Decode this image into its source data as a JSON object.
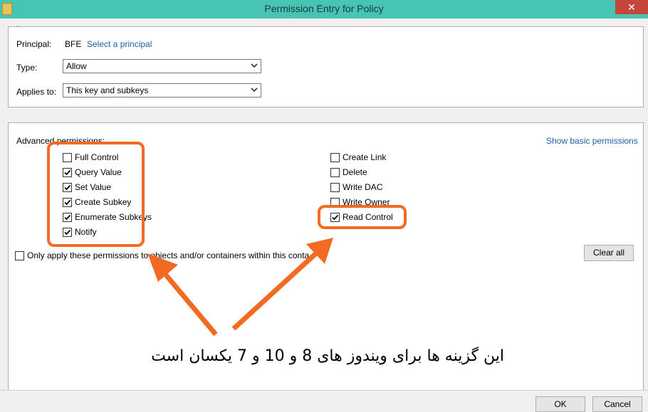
{
  "window": {
    "title": "Permission Entry for Policy",
    "close_glyph": "✕"
  },
  "principal": {
    "label": "Principal:",
    "value": "BFE",
    "select_link": "Select a principal"
  },
  "type": {
    "label": "Type:",
    "value": "Allow"
  },
  "applies_to": {
    "label": "Applies to:",
    "value": "This key and subkeys"
  },
  "advanced": {
    "label": "Advanced permissions:",
    "show_basic_link": "Show basic permissions",
    "left_permissions": [
      {
        "label": "Full Control",
        "checked": false
      },
      {
        "label": "Query Value",
        "checked": true
      },
      {
        "label": "Set Value",
        "checked": true
      },
      {
        "label": "Create Subkey",
        "checked": true
      },
      {
        "label": "Enumerate Subkeys",
        "checked": true
      },
      {
        "label": "Notify",
        "checked": true
      }
    ],
    "right_permissions": [
      {
        "label": "Create Link",
        "checked": false
      },
      {
        "label": "Delete",
        "checked": false
      },
      {
        "label": "Write DAC",
        "checked": false
      },
      {
        "label": "Write Owner",
        "checked": false
      },
      {
        "label": "Read Control",
        "checked": true
      }
    ],
    "only_apply_label": "Only apply these permissions to objects and/or containers within this conta",
    "only_apply_checked": false,
    "clear_all": "Clear all"
  },
  "annotation": {
    "caption": "این گزینه ها برای ویندوز های 8 و 10 و 7 یکسان است",
    "accent_color": "#f26b22"
  },
  "footer": {
    "ok": "OK",
    "cancel": "Cancel"
  },
  "colors": {
    "titlebar": "#47c4b3",
    "link": "#1f5fa8",
    "close": "#c7463a"
  }
}
